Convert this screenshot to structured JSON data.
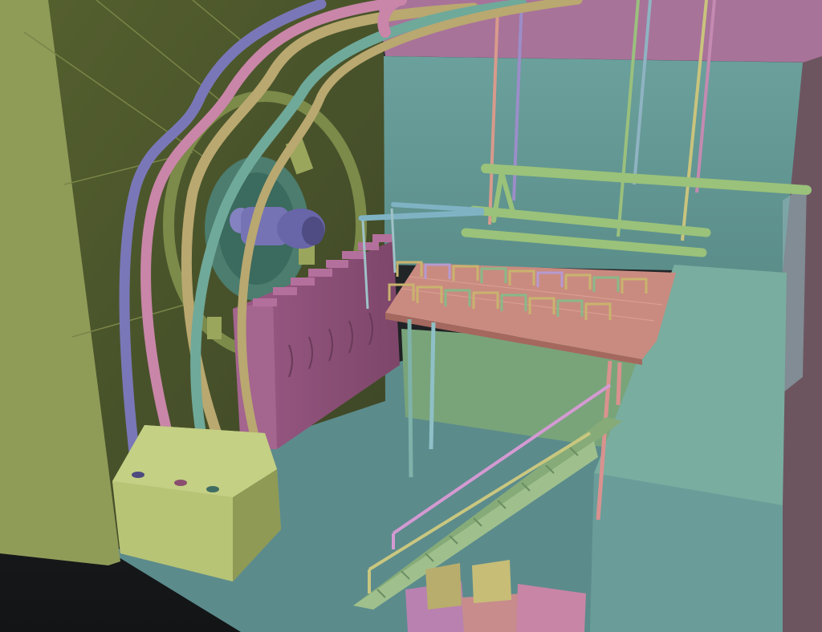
{
  "scene": {
    "description_label": "",
    "palette": {
      "background_dark": "#1b1d1f",
      "background_mid": "#3b4046",
      "wall_olive": "#4d5a30",
      "wall_olive_light": "#8f9a55",
      "wall_teal": "#5e9590",
      "floor_teal": "#5d8c8e",
      "ceiling_pink": "#a56f96",
      "rack_magenta": "#8e5279",
      "cable_blue": "#7a77b8",
      "cable_pink": "#c986a8",
      "cable_tan": "#b9a870",
      "cable_teal": "#6fa99a",
      "platform_salmon": "#c88a7e",
      "stairs_green": "#86ab78",
      "box_yellow": "#b6ad6c",
      "box_pink": "#c187a6"
    },
    "objects": [
      "left-wall",
      "hatch-ring",
      "turbine-engine",
      "cable-bundle",
      "junction-box",
      "server-rack",
      "catwalk-platform",
      "railings",
      "ceiling-rods",
      "pipe-rails",
      "staircase",
      "crate-stack"
    ]
  }
}
